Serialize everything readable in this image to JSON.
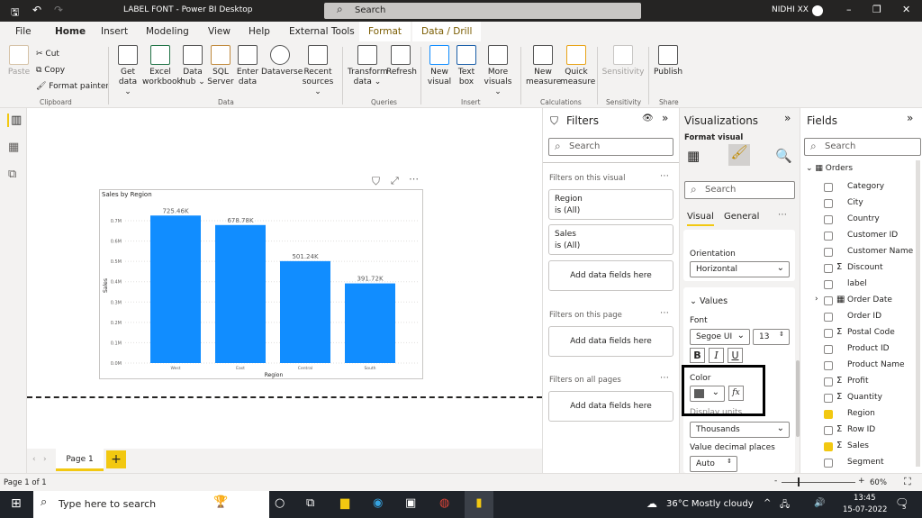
{
  "titlebar": {
    "title": "LABEL FONT - Power BI Desktop",
    "search_placeholder": "Search",
    "user": "NIDHI XX"
  },
  "tabs": [
    "File",
    "Home",
    "Insert",
    "Modeling",
    "View",
    "Help",
    "External Tools",
    "Format",
    "Data / Drill"
  ],
  "ribbon": {
    "clipboard": {
      "paste": "Paste",
      "cut": "Cut",
      "copy": "Copy",
      "format_painter": "Format painter",
      "group": "Clipboard"
    },
    "data": {
      "items": [
        "Get data ⌄",
        "Excel workbook",
        "Data hub ⌄",
        "SQL Server",
        "Enter data",
        "Dataverse",
        "Recent sources ⌄"
      ],
      "group": "Data"
    },
    "queries": {
      "items": [
        "Transform data ⌄",
        "Refresh"
      ],
      "group": "Queries"
    },
    "insert": {
      "items": [
        "New visual",
        "Text box",
        "More visuals ⌄"
      ],
      "group": "Insert"
    },
    "calculations": {
      "items": [
        "New measure",
        "Quick measure"
      ],
      "group": "Calculations"
    },
    "sensitivity": {
      "items": [
        "Sensitivity"
      ],
      "group": "Sensitivity"
    },
    "share": {
      "items": [
        "Publish"
      ],
      "group": "Share"
    }
  },
  "chart_data": {
    "type": "bar",
    "title": "Sales by Region",
    "xlabel": "Region",
    "ylabel": "Sales",
    "categories": [
      "West",
      "East",
      "Central",
      "South"
    ],
    "values": [
      725.46,
      678.78,
      501.24,
      391.72
    ],
    "data_labels": [
      "725.46K",
      "678.78K",
      "501.24K",
      "391.72K"
    ],
    "yticks": [
      "0.0M",
      "0.1M",
      "0.2M",
      "0.3M",
      "0.4M",
      "0.5M",
      "0.6M",
      "0.7M"
    ],
    "ylim": [
      0,
      700
    ],
    "units": "K",
    "bar_color": "#118dff",
    "grid": true
  },
  "pages": {
    "tabs": [
      "Page 1"
    ],
    "add": "+"
  },
  "status": {
    "page": "Page 1 of 1",
    "zoom": "60%"
  },
  "filters": {
    "title": "Filters",
    "search": "Search",
    "on_visual": "Filters on this visual",
    "cards": [
      {
        "field": "Region",
        "value": "is (All)"
      },
      {
        "field": "Sales",
        "value": "is (All)"
      }
    ],
    "add": "Add data fields here",
    "on_page": "Filters on this page",
    "on_all": "Filters on all pages"
  },
  "viz": {
    "title": "Visualizations",
    "format_visual": "Format visual",
    "search": "Search",
    "tab_visual": "Visual",
    "tab_general": "General",
    "orientation_label": "Orientation",
    "orientation": "Horizontal",
    "values_section": "Values",
    "font_label": "Font",
    "font": "Segoe UI",
    "font_size": "13",
    "bold": "B",
    "italic": "I",
    "underline": "U",
    "color_label": "Color",
    "color": "#5c5c5c",
    "fx": "fx",
    "display_units_label": "Display units",
    "display_units": "Thousands",
    "decimal_label": "Value decimal places",
    "decimal": "Auto"
  },
  "fields": {
    "title": "Fields",
    "search": "Search",
    "table": "Orders",
    "items": [
      {
        "name": "Category",
        "sigma": false,
        "checked": false
      },
      {
        "name": "City",
        "sigma": false,
        "checked": false
      },
      {
        "name": "Country",
        "sigma": false,
        "checked": false
      },
      {
        "name": "Customer ID",
        "sigma": false,
        "checked": false
      },
      {
        "name": "Customer Name",
        "sigma": false,
        "checked": false
      },
      {
        "name": "Discount",
        "sigma": true,
        "checked": false
      },
      {
        "name": "label",
        "sigma": false,
        "checked": false
      },
      {
        "name": "Order Date",
        "sigma": false,
        "checked": false
      },
      {
        "name": "Order ID",
        "sigma": false,
        "checked": false
      },
      {
        "name": "Postal Code",
        "sigma": true,
        "checked": false
      },
      {
        "name": "Product ID",
        "sigma": false,
        "checked": false
      },
      {
        "name": "Product Name",
        "sigma": false,
        "checked": false
      },
      {
        "name": "Profit",
        "sigma": true,
        "checked": false
      },
      {
        "name": "Quantity",
        "sigma": true,
        "checked": false
      },
      {
        "name": "Region",
        "sigma": false,
        "checked": true
      },
      {
        "name": "Row ID",
        "sigma": true,
        "checked": false
      },
      {
        "name": "Sales",
        "sigma": true,
        "checked": true
      },
      {
        "name": "Segment",
        "sigma": false,
        "checked": false
      }
    ]
  },
  "taskbar": {
    "search": "Type here to search",
    "weather": "36°C  Mostly cloudy",
    "time": "13:45",
    "date": "15-07-2022",
    "notifications": "5"
  }
}
